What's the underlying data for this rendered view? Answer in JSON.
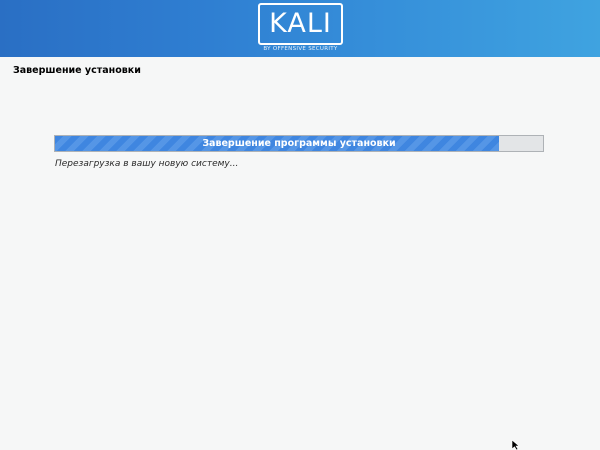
{
  "banner": {
    "logo_text": "KALI",
    "logo_subtitle": "BY OFFENSIVE SECURITY"
  },
  "page": {
    "title": "Завершение установки"
  },
  "progress": {
    "label": "Завершение программы установки",
    "fraction": 0.91
  },
  "status": {
    "message": "Перезагрузка в вашу новую систему..."
  },
  "icons": {
    "pointer": "mouse-pointer-icon"
  },
  "colors": {
    "banner_start": "#2a6fc4",
    "banner_end": "#3fa3e0",
    "progress_fill": "#3f86e0",
    "background": "#f6f7f7"
  }
}
